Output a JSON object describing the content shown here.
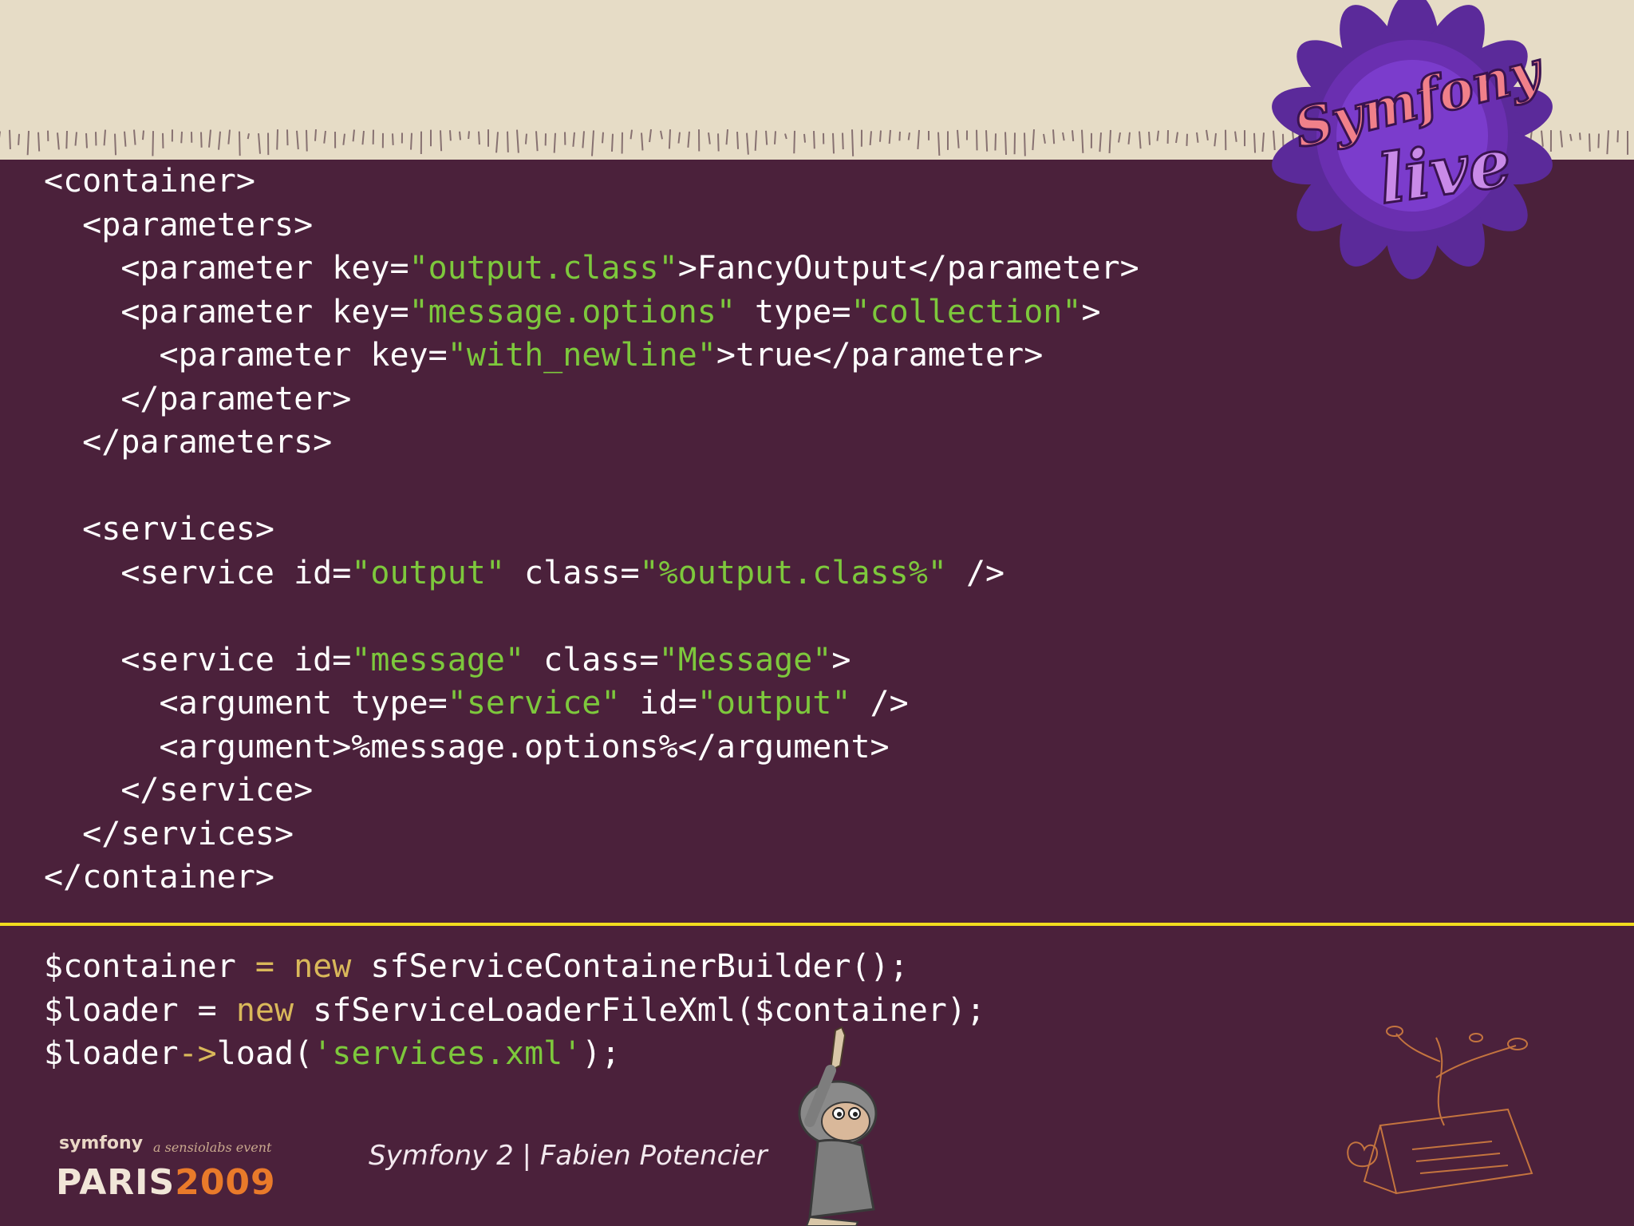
{
  "brand": {
    "event_logo_line1": "Symfony",
    "event_logo_line2": "live",
    "footer_logo_top": "symfony",
    "footer_logo_sub": "a sensiolabs event",
    "footer_logo_city": "PARIS",
    "footer_logo_year": "2009",
    "caption": "Symfony 2 | Fabien Potencier"
  },
  "colors": {
    "background": "#4b213b",
    "header_band": "#e6dcc6",
    "string_literal": "#7dc83c",
    "keyword": "#d9b85a",
    "divider": "#f1dc1e",
    "text": "#ffffff"
  },
  "xml_code": {
    "l1": "<container>",
    "l2": "  <parameters>",
    "l3_a": "    <parameter key=",
    "l3_s": "\"output.class\"",
    "l3_b": ">FancyOutput</parameter>",
    "l4_a": "    <parameter key=",
    "l4_s1": "\"message.options\"",
    "l4_b": " type=",
    "l4_s2": "\"collection\"",
    "l4_c": ">",
    "l5_a": "      <parameter key=",
    "l5_s": "\"with_newline\"",
    "l5_b": ">true</parameter>",
    "l6": "    </parameter>",
    "l7": "  </parameters>",
    "l9": "  <services>",
    "l10_a": "    <service id=",
    "l10_s1": "\"output\"",
    "l10_b": " class=",
    "l10_s2": "\"%output.class%\"",
    "l10_c": " />",
    "l12_a": "    <service id=",
    "l12_s1": "\"message\"",
    "l12_b": " class=",
    "l12_s2": "\"Message\"",
    "l12_c": ">",
    "l13_a": "      <argument type=",
    "l13_s1": "\"service\"",
    "l13_b": " id=",
    "l13_s2": "\"output\"",
    "l13_c": " />",
    "l14": "      <argument>%message.options%</argument>",
    "l15": "    </service>",
    "l16": "  </services>",
    "l17": "</container>"
  },
  "php_code": {
    "l1_a": "$container ",
    "l1_op": "=",
    "l1_sp": " ",
    "l1_kw": "new",
    "l1_b": " sfServiceContainerBuilder();",
    "l2_a": "$loader = ",
    "l2_kw": "new",
    "l2_b": " sfServiceLoaderFileXml($container);",
    "l3_a": "$loader",
    "l3_op": "->",
    "l3_b": "load(",
    "l3_s": "'services.xml'",
    "l3_c": ");"
  }
}
